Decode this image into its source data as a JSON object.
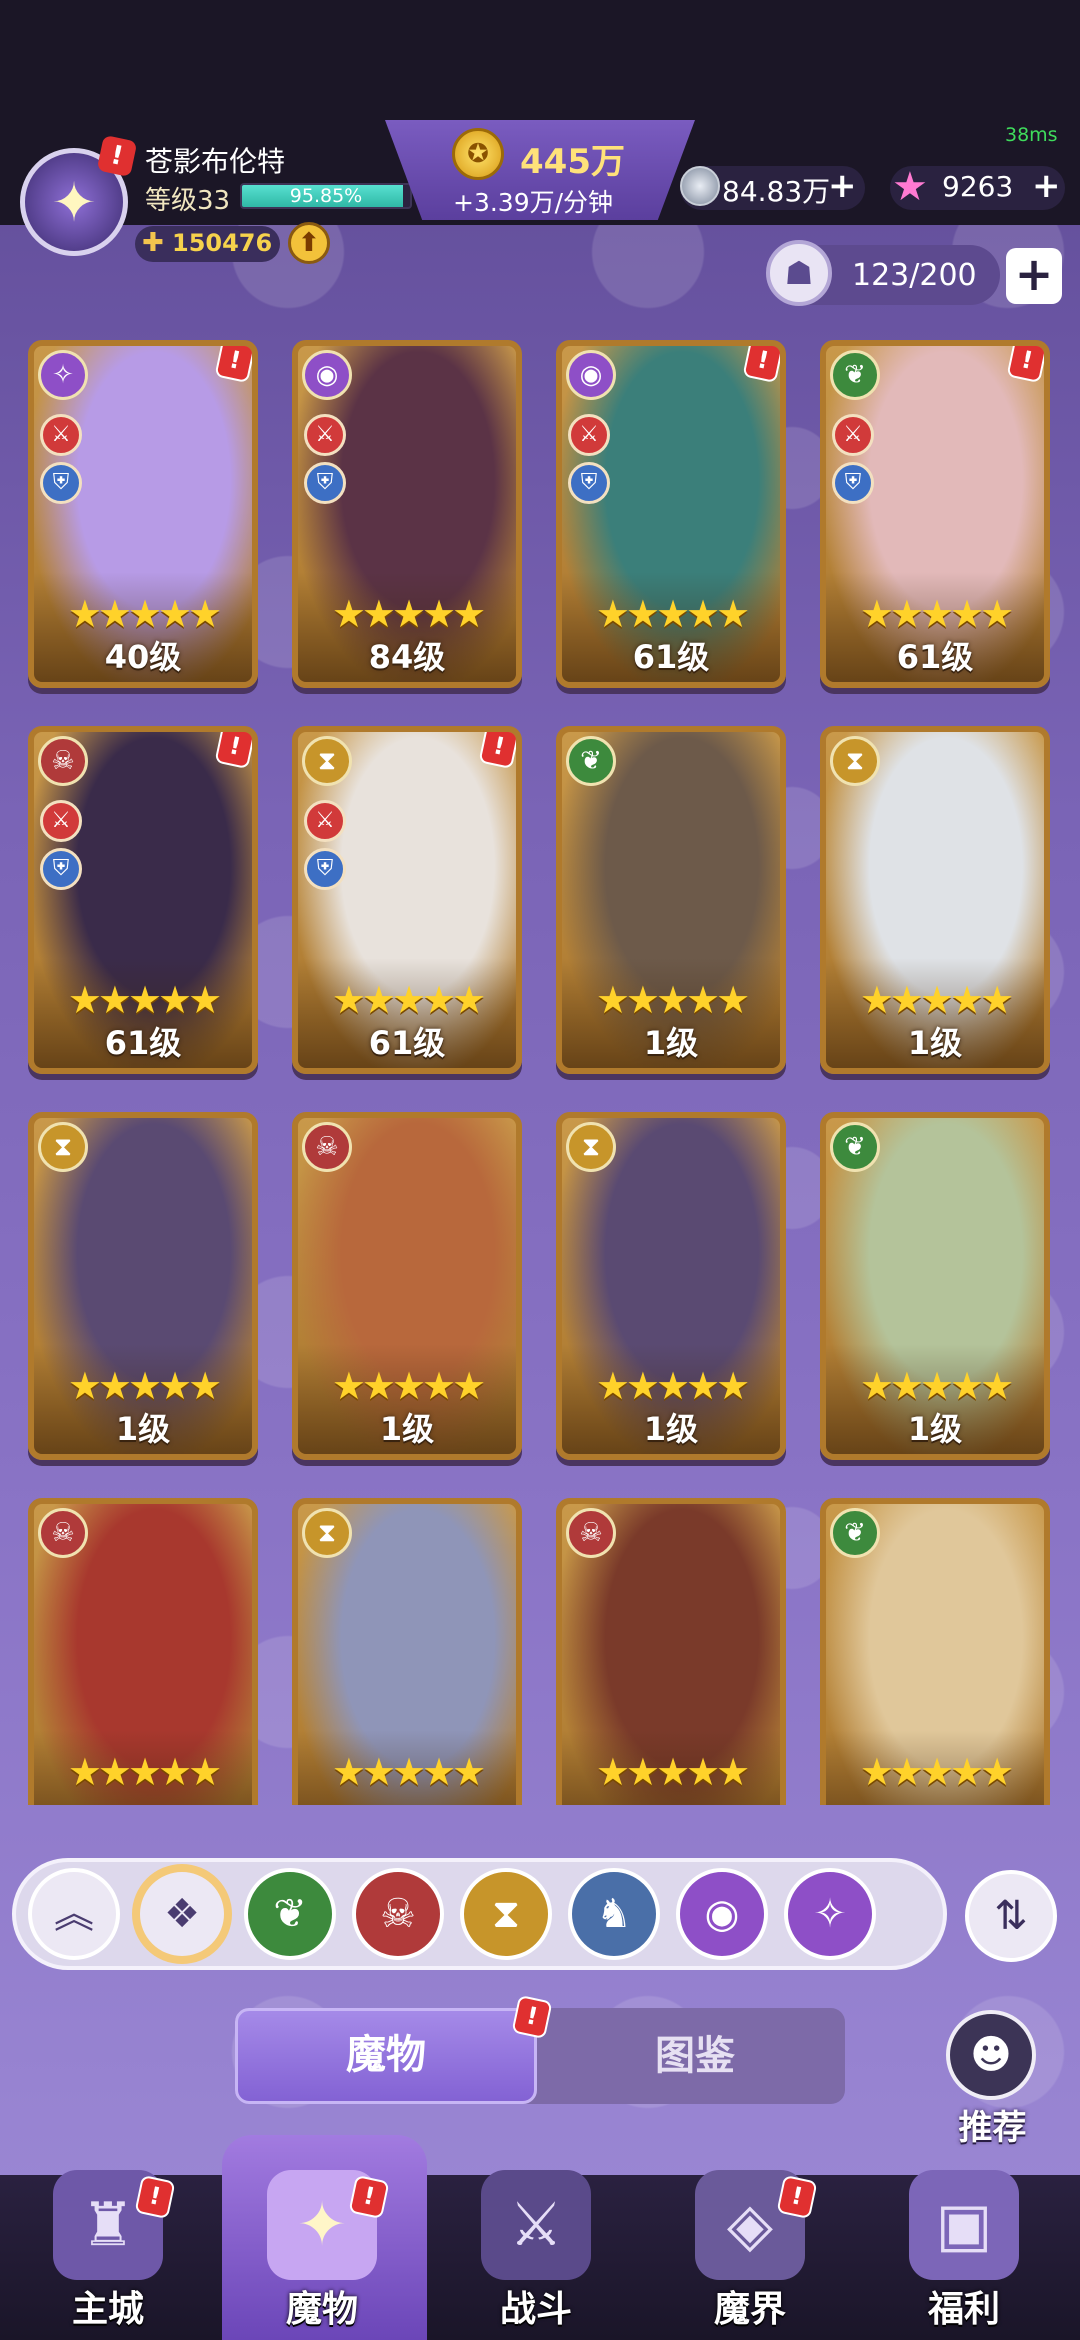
{
  "player": {
    "name": "苍影布伦特",
    "level_label": "等级33",
    "exp_percent_text": "95.85%",
    "exp_fraction": 0.9585,
    "power": "150476",
    "avatar_icon": "winged-star-icon"
  },
  "resources": {
    "gold": "445万",
    "gold_rate": "+3.39万/分钟",
    "silver": "84.83万",
    "stars": "9263",
    "ping": "38ms"
  },
  "capacity": {
    "value": "123/200"
  },
  "cards": [
    {
      "level": "40级",
      "faction_icon": "swirl-icon",
      "faction_color": "#8e4fc7",
      "stars": 5,
      "atk": true,
      "def": true,
      "alert": true,
      "art": "#b79be6"
    },
    {
      "level": "84级",
      "faction_icon": "eye-icon",
      "faction_color": "#8e4fc7",
      "stars": 5,
      "atk": true,
      "def": true,
      "alert": false,
      "art": "#5b3346"
    },
    {
      "level": "61级",
      "faction_icon": "eye-icon",
      "faction_color": "#8e4fc7",
      "stars": 5,
      "atk": true,
      "def": true,
      "alert": true,
      "art": "#3b7f7a"
    },
    {
      "level": "61级",
      "faction_icon": "leaf-icon",
      "faction_color": "#3d8a3d",
      "stars": 5,
      "atk": true,
      "def": true,
      "alert": true,
      "art": "#e2b9b9"
    },
    {
      "level": "61级",
      "faction_icon": "demon-icon",
      "faction_color": "#b03a3a",
      "stars": 5,
      "atk": true,
      "def": true,
      "alert": true,
      "art": "#3a2b4a"
    },
    {
      "level": "61级",
      "faction_icon": "hourglass-icon",
      "faction_color": "#c7952a",
      "stars": 5,
      "atk": true,
      "def": true,
      "alert": true,
      "art": "#e8e2dc"
    },
    {
      "level": "1级",
      "faction_icon": "leaf-icon",
      "faction_color": "#3d8a3d",
      "stars": 5,
      "atk": false,
      "def": false,
      "alert": false,
      "art": "#6d5a4a"
    },
    {
      "level": "1级",
      "faction_icon": "hourglass-icon",
      "faction_color": "#c7952a",
      "stars": 5,
      "atk": false,
      "def": false,
      "alert": false,
      "art": "#dfe2e6"
    },
    {
      "level": "1级",
      "faction_icon": "hourglass-icon",
      "faction_color": "#c7952a",
      "stars": 5,
      "atk": false,
      "def": false,
      "alert": false,
      "art": "#5a4a72"
    },
    {
      "level": "1级",
      "faction_icon": "demon-icon",
      "faction_color": "#b03a3a",
      "stars": 5,
      "atk": false,
      "def": false,
      "alert": false,
      "art": "#b8683c"
    },
    {
      "level": "1级",
      "faction_icon": "hourglass-icon",
      "faction_color": "#c7952a",
      "stars": 5,
      "atk": false,
      "def": false,
      "alert": false,
      "art": "#5a4a72"
    },
    {
      "level": "1级",
      "faction_icon": "leaf-icon",
      "faction_color": "#3d8a3d",
      "stars": 5,
      "atk": false,
      "def": false,
      "alert": false,
      "art": "#b4c39a"
    },
    {
      "level": "",
      "faction_icon": "demon-icon",
      "faction_color": "#b03a3a",
      "stars": 5,
      "atk": false,
      "def": false,
      "alert": false,
      "art": "#a8382e"
    },
    {
      "level": "",
      "faction_icon": "hourglass-icon",
      "faction_color": "#c7952a",
      "stars": 5,
      "atk": false,
      "def": false,
      "alert": false,
      "art": "#8f95b8"
    },
    {
      "level": "",
      "faction_icon": "demon-icon",
      "faction_color": "#b03a3a",
      "stars": 5,
      "atk": false,
      "def": false,
      "alert": false,
      "art": "#7a3a2a"
    },
    {
      "level": "",
      "faction_icon": "leaf-icon",
      "faction_color": "#3d8a3d",
      "stars": 5,
      "atk": false,
      "def": false,
      "alert": false,
      "art": "#e0c79a"
    }
  ],
  "filters": [
    {
      "name": "collapse",
      "icon": "double-chevron-up-icon",
      "color": "#ece8f4"
    },
    {
      "name": "all",
      "icon": "diamond-grid-icon",
      "color": "#ece8f4",
      "selected": true
    },
    {
      "name": "forest",
      "icon": "leaf-icon",
      "color": "#3d8a3d"
    },
    {
      "name": "demon",
      "icon": "demon-icon",
      "color": "#b03a3a"
    },
    {
      "name": "time",
      "icon": "hourglass-icon",
      "color": "#c7952a"
    },
    {
      "name": "dragon",
      "icon": "dragon-icon",
      "color": "#4a6fa8"
    },
    {
      "name": "eye",
      "icon": "eye-icon",
      "color": "#8e4fc7"
    },
    {
      "name": "swirl",
      "icon": "swirl-icon",
      "color": "#8e4fc7"
    }
  ],
  "tabs": {
    "monsters": "魔物",
    "codex": "图鉴"
  },
  "recommend_label": "推荐",
  "nav": [
    {
      "label": "主城",
      "icon": "castle-icon",
      "alert": true
    },
    {
      "label": "魔物",
      "icon": "flame-star-icon",
      "alert": true,
      "active": true
    },
    {
      "label": "战斗",
      "icon": "sword-shield-icon",
      "alert": false
    },
    {
      "label": "魔界",
      "icon": "portal-icon",
      "alert": true
    },
    {
      "label": "福利",
      "icon": "treasure-chest-icon",
      "alert": false
    }
  ]
}
